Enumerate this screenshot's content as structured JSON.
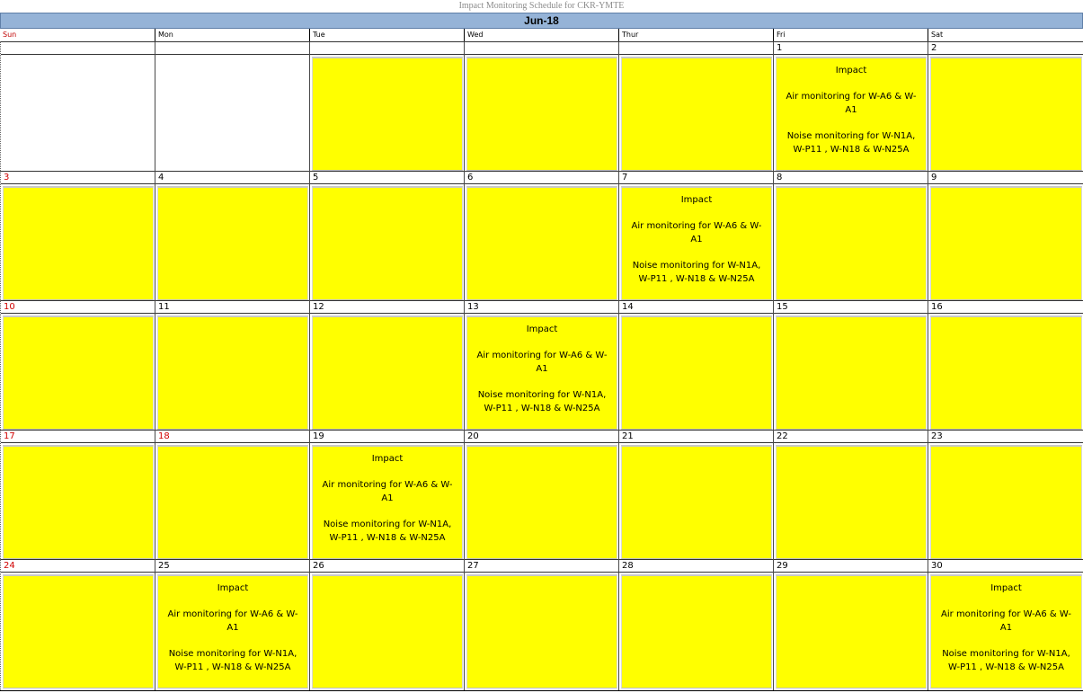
{
  "title": "Impact Monitoring Schedule for CKR-YMTE",
  "month": "Jun-18",
  "days_of_week": [
    "Sun",
    "Mon",
    "Tue",
    "Wed",
    "Thur",
    "Fri",
    "Sat"
  ],
  "event": {
    "heading": "Impact",
    "air": "Air monitoring for W-A6 & W-A1",
    "noise": "Noise monitoring for W-N1A, W-P11 , W-N18 & W-N25A"
  },
  "weeks": [
    [
      {
        "day": "",
        "fill": "none",
        "event": false
      },
      {
        "day": "",
        "fill": "none",
        "event": false
      },
      {
        "day": "",
        "fill": "yellow",
        "event": false
      },
      {
        "day": "",
        "fill": "yellow",
        "event": false
      },
      {
        "day": "",
        "fill": "yellow",
        "event": false
      },
      {
        "day": "1",
        "fill": "yellow",
        "event": true
      },
      {
        "day": "2",
        "fill": "yellow",
        "event": false
      }
    ],
    [
      {
        "day": "3",
        "fill": "yellow",
        "event": false,
        "red": true
      },
      {
        "day": "4",
        "fill": "yellow",
        "event": false
      },
      {
        "day": "5",
        "fill": "yellow",
        "event": false
      },
      {
        "day": "6",
        "fill": "yellow",
        "event": false
      },
      {
        "day": "7",
        "fill": "yellow",
        "event": true
      },
      {
        "day": "8",
        "fill": "yellow",
        "event": false
      },
      {
        "day": "9",
        "fill": "yellow",
        "event": false
      }
    ],
    [
      {
        "day": "10",
        "fill": "yellow",
        "event": false,
        "red": true
      },
      {
        "day": "11",
        "fill": "yellow",
        "event": false
      },
      {
        "day": "12",
        "fill": "yellow",
        "event": false
      },
      {
        "day": "13",
        "fill": "yellow",
        "event": true
      },
      {
        "day": "14",
        "fill": "yellow",
        "event": false
      },
      {
        "day": "15",
        "fill": "yellow",
        "event": false
      },
      {
        "day": "16",
        "fill": "yellow",
        "event": false
      }
    ],
    [
      {
        "day": "17",
        "fill": "yellow",
        "event": false,
        "red": true
      },
      {
        "day": "18",
        "fill": "yellow",
        "event": false,
        "red": true
      },
      {
        "day": "19",
        "fill": "yellow",
        "event": true
      },
      {
        "day": "20",
        "fill": "yellow",
        "event": false
      },
      {
        "day": "21",
        "fill": "yellow",
        "event": false
      },
      {
        "day": "22",
        "fill": "yellow",
        "event": false
      },
      {
        "day": "23",
        "fill": "yellow",
        "event": false
      }
    ],
    [
      {
        "day": "24",
        "fill": "yellow",
        "event": false,
        "red": true
      },
      {
        "day": "25",
        "fill": "yellow",
        "event": true
      },
      {
        "day": "26",
        "fill": "yellow",
        "event": false
      },
      {
        "day": "27",
        "fill": "yellow",
        "event": false
      },
      {
        "day": "28",
        "fill": "yellow",
        "event": false
      },
      {
        "day": "29",
        "fill": "yellow",
        "event": false
      },
      {
        "day": "30",
        "fill": "yellow",
        "event": true
      }
    ]
  ],
  "colors": {
    "month_bar": "#95b3d7",
    "cell_fill": "#ffff00",
    "sunday_red": "#c00000",
    "holiday_red": "#d00000"
  }
}
